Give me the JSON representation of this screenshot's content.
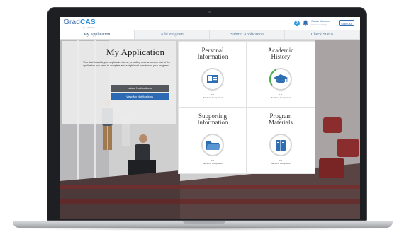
{
  "app": {
    "logo_prefix": "Grad",
    "logo_suffix": "CAS",
    "logo_sub": "by LIAISON",
    "user_name": "Sarah Johnson",
    "user_sub": "Account Settings",
    "signout_label": "Sign Out"
  },
  "tabs": [
    {
      "label": "My Application",
      "active": true
    },
    {
      "label": "Add Program",
      "active": false
    },
    {
      "label": "Submit Application",
      "active": false
    },
    {
      "label": "Check Status",
      "active": false
    }
  ],
  "intro": {
    "title": "My Application",
    "text": "This dashboard is your application home, providing access to each part of the application you need to complete and a high level overview of your progress.",
    "notifications_label": "Latest Notifications",
    "view_button_label": "View My Notifications"
  },
  "sections": [
    {
      "title_line1": "Personal",
      "title_line2": "Information",
      "status_count": "0/4",
      "status_label": "Sections Completed",
      "progress": 0,
      "icon": "id-card-icon"
    },
    {
      "title_line1": "Academic",
      "title_line2": "History",
      "status_count": "1/7",
      "status_label": "Sections Completed",
      "progress": 0.14,
      "icon": "graduation-cap-icon"
    },
    {
      "title_line1": "Supporting",
      "title_line2": "Information",
      "status_count": "0/3",
      "status_label": "Sections Completed",
      "progress": 0,
      "icon": "folder-icon"
    },
    {
      "title_line1": "Program",
      "title_line2": "Materials",
      "status_count": "0/2",
      "status_label": "Sections Completed",
      "progress": 0,
      "icon": "book-icon"
    }
  ],
  "colors": {
    "accent": "#2c6bb3",
    "ring_track": "#d6d6d6",
    "ring_progress": "#4caf50",
    "icon_blue": "#2f6fb1"
  }
}
